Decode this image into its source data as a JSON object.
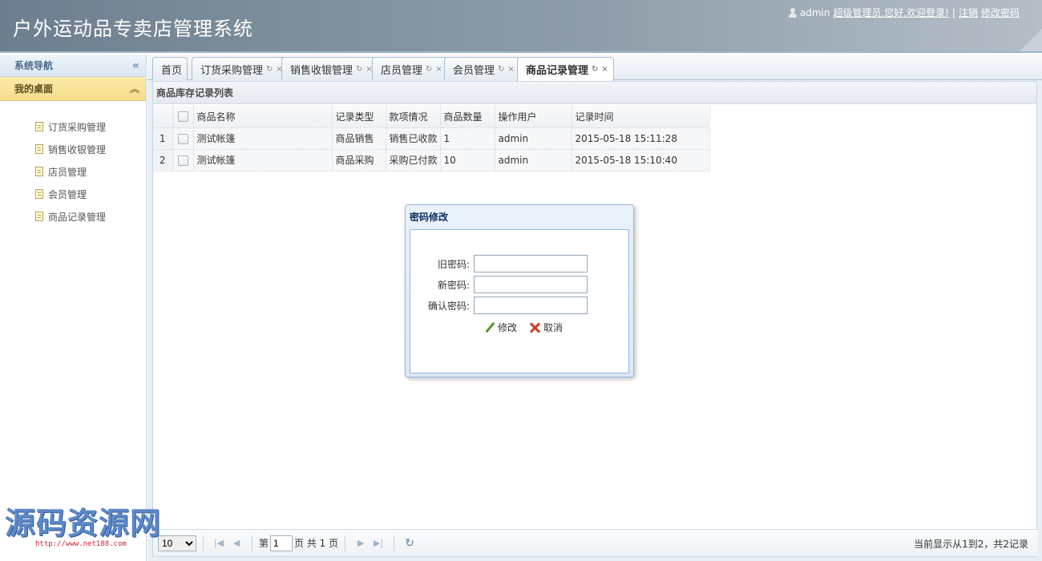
{
  "header": {
    "title": "户外运动品专卖店管理系统",
    "user": "admin",
    "greeting": "超级管理员,您好,欢迎登录!",
    "separator": "|",
    "logout": "注销",
    "change_password": "修改密码"
  },
  "sidebar": {
    "title": "系统导航",
    "collapse_icon": "double-chevron-left-icon",
    "section": "我的桌面",
    "items": [
      {
        "label": "订货采购管理"
      },
      {
        "label": "销售收银管理"
      },
      {
        "label": "店员管理"
      },
      {
        "label": "会员管理"
      },
      {
        "label": "商品记录管理"
      }
    ]
  },
  "tabs": [
    {
      "label": "首页",
      "closable": false
    },
    {
      "label": "订货采购管理",
      "closable": true
    },
    {
      "label": "销售收银管理",
      "closable": true
    },
    {
      "label": "店员管理",
      "closable": true
    },
    {
      "label": "会员管理",
      "closable": true
    },
    {
      "label": "商品记录管理",
      "closable": true,
      "active": true
    }
  ],
  "tab_refresh_glyph": "↻",
  "tab_close_glyph": "×",
  "panel": {
    "title": "商品库存记录列表",
    "columns": [
      "商品名称",
      "记录类型",
      "款项情况",
      "商品数量",
      "操作用户",
      "记录时间"
    ],
    "rows": [
      {
        "no": "1",
        "name": "测试帐篷",
        "type": "商品销售",
        "payment": "销售已收款",
        "qty": "1",
        "user": "admin",
        "time": "2015-05-18 15:11:28"
      },
      {
        "no": "2",
        "name": "测试帐篷",
        "type": "商品采购",
        "payment": "采购已付款",
        "qty": "10",
        "user": "admin",
        "time": "2015-05-18 15:10:40"
      }
    ]
  },
  "pager": {
    "page_size": "10",
    "page_prefix": "第",
    "page_value": "1",
    "page_suffix": "页 共 1 页",
    "info": "当前显示从1到2，共2记录"
  },
  "dialog": {
    "title": "密码修改",
    "old_label": "旧密码:",
    "new_label": "新密码:",
    "confirm_label": "确认密码:",
    "submit": "修改",
    "cancel": "取消"
  },
  "watermark": {
    "text": "源码资源网",
    "url": "http://www.net188.com"
  }
}
